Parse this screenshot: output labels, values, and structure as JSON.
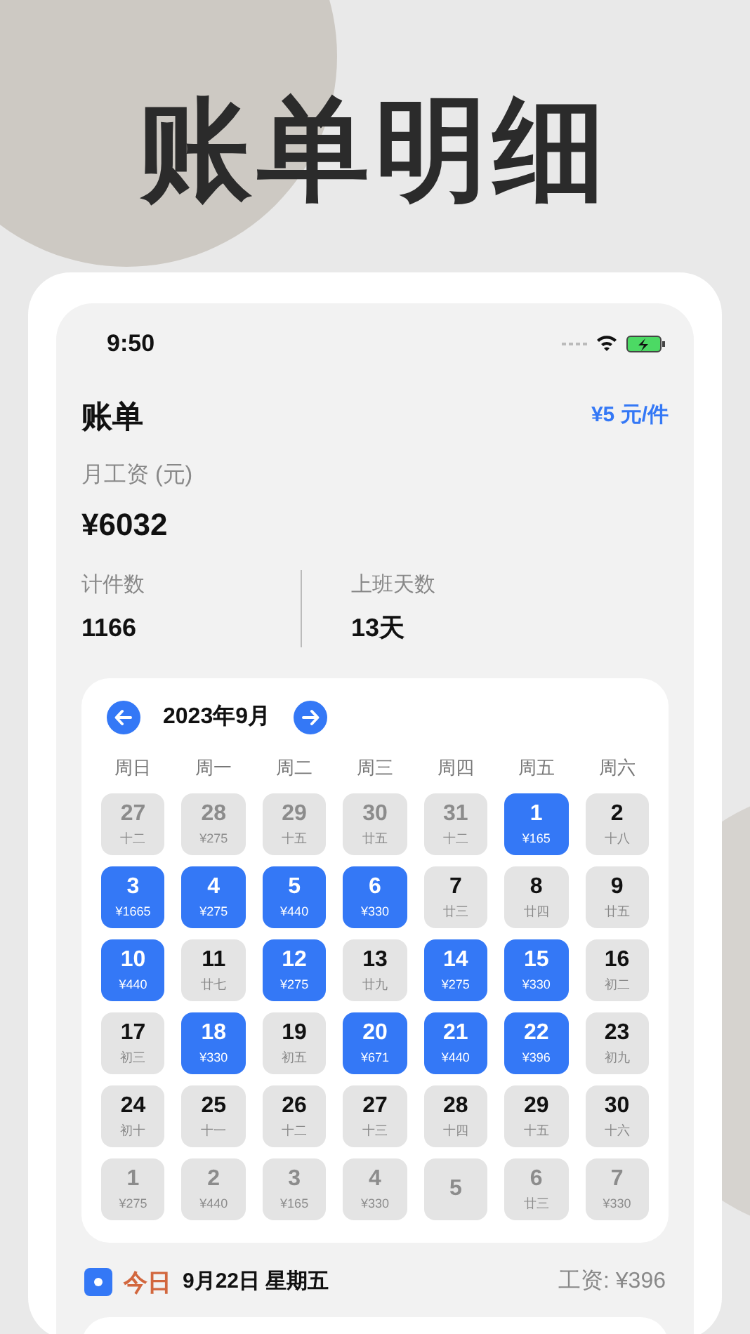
{
  "headline": "账单明细",
  "status_bar": {
    "time": "9:50"
  },
  "header": {
    "title": "账单",
    "rate": "¥5 元/件"
  },
  "salary": {
    "label": "月工资 (元)",
    "value": "¥6032"
  },
  "stats": [
    {
      "label": "计件数",
      "value": "1166"
    },
    {
      "label": "上班天数",
      "value": "13天"
    }
  ],
  "calendar": {
    "month": "2023年9月",
    "weekdays": [
      "周日",
      "周一",
      "周二",
      "周三",
      "周四",
      "周五",
      "周六"
    ],
    "days": [
      {
        "day": "27",
        "sub": "十二",
        "kind": "outside"
      },
      {
        "day": "28",
        "sub": "¥275",
        "kind": "outside"
      },
      {
        "day": "29",
        "sub": "十五",
        "kind": "outside"
      },
      {
        "day": "30",
        "sub": "廿五",
        "kind": "outside"
      },
      {
        "day": "31",
        "sub": "十二",
        "kind": "outside"
      },
      {
        "day": "1",
        "sub": "¥165",
        "kind": "worked"
      },
      {
        "day": "2",
        "sub": "十八",
        "kind": "normal"
      },
      {
        "day": "3",
        "sub": "¥1665",
        "kind": "worked"
      },
      {
        "day": "4",
        "sub": "¥275",
        "kind": "worked"
      },
      {
        "day": "5",
        "sub": "¥440",
        "kind": "worked"
      },
      {
        "day": "6",
        "sub": "¥330",
        "kind": "worked"
      },
      {
        "day": "7",
        "sub": "廿三",
        "kind": "normal"
      },
      {
        "day": "8",
        "sub": "廿四",
        "kind": "normal"
      },
      {
        "day": "9",
        "sub": "廿五",
        "kind": "normal"
      },
      {
        "day": "10",
        "sub": "¥440",
        "kind": "worked"
      },
      {
        "day": "11",
        "sub": "廿七",
        "kind": "normal"
      },
      {
        "day": "12",
        "sub": "¥275",
        "kind": "worked"
      },
      {
        "day": "13",
        "sub": "廿九",
        "kind": "normal"
      },
      {
        "day": "14",
        "sub": "¥275",
        "kind": "worked"
      },
      {
        "day": "15",
        "sub": "¥330",
        "kind": "worked"
      },
      {
        "day": "16",
        "sub": "初二",
        "kind": "normal"
      },
      {
        "day": "17",
        "sub": "初三",
        "kind": "normal"
      },
      {
        "day": "18",
        "sub": "¥330",
        "kind": "worked"
      },
      {
        "day": "19",
        "sub": "初五",
        "kind": "normal"
      },
      {
        "day": "20",
        "sub": "¥671",
        "kind": "worked"
      },
      {
        "day": "21",
        "sub": "¥440",
        "kind": "worked"
      },
      {
        "day": "22",
        "sub": "¥396",
        "kind": "worked"
      },
      {
        "day": "23",
        "sub": "初九",
        "kind": "normal"
      },
      {
        "day": "24",
        "sub": "初十",
        "kind": "normal"
      },
      {
        "day": "25",
        "sub": "十一",
        "kind": "normal"
      },
      {
        "day": "26",
        "sub": "十二",
        "kind": "normal"
      },
      {
        "day": "27",
        "sub": "十三",
        "kind": "normal"
      },
      {
        "day": "28",
        "sub": "十四",
        "kind": "normal"
      },
      {
        "day": "29",
        "sub": "十五",
        "kind": "normal"
      },
      {
        "day": "30",
        "sub": "十六",
        "kind": "normal"
      },
      {
        "day": "1",
        "sub": "¥275",
        "kind": "outside"
      },
      {
        "day": "2",
        "sub": "¥440",
        "kind": "outside"
      },
      {
        "day": "3",
        "sub": "¥165",
        "kind": "outside"
      },
      {
        "day": "4",
        "sub": "¥330",
        "kind": "outside"
      },
      {
        "day": "5",
        "kind": "outside"
      },
      {
        "day": "6",
        "sub": "廿三",
        "kind": "outside"
      },
      {
        "day": "7",
        "sub": "¥330",
        "kind": "outside"
      }
    ]
  },
  "today": {
    "label": "今日",
    "date": "9月22日 星期五",
    "wage": "工资: ¥396"
  }
}
